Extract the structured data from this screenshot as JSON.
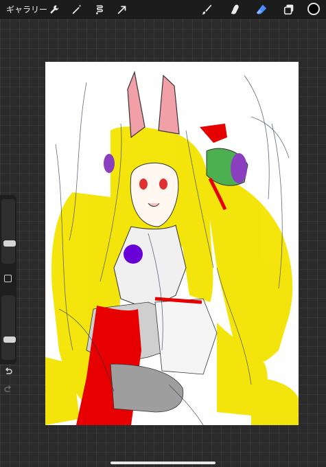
{
  "topbar": {
    "gallery_label": "ギャラリー",
    "tools_left": [
      "wrench-icon",
      "magic-wand-icon",
      "selection-icon",
      "transform-arrow-icon"
    ],
    "tools_right": [
      "brush-icon",
      "smudge-icon",
      "eraser-icon",
      "layers-icon"
    ],
    "active_tool": "eraser-icon",
    "active_color": "#000000"
  },
  "sidebar": {
    "brush_size_level": 0.3,
    "opacity_level": 0.3
  },
  "colors": {
    "accent": "#4a8cff",
    "canvas_bg": "#ffffff",
    "hair_yellow": "#f3e400",
    "ribbon_red": "#e60000"
  }
}
